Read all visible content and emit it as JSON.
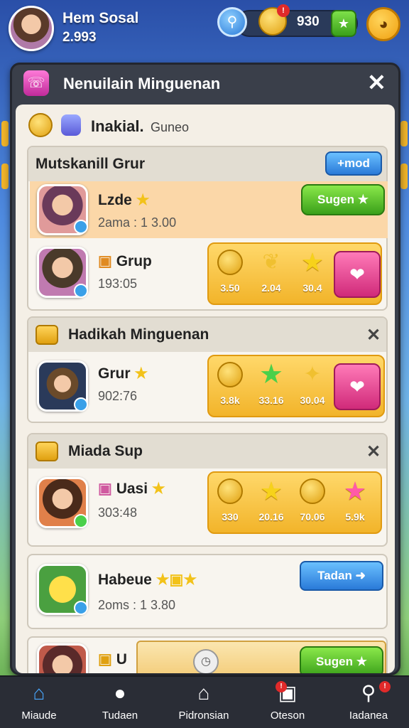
{
  "topbar": {
    "player_name": "Hem Sosal",
    "player_score": "2.993",
    "coin_badge": "!",
    "coin_count": "930"
  },
  "panel": {
    "title": "Nenuilain Minguenan",
    "filter_label": "Inakial.",
    "filter_sub": "Guneo"
  },
  "sections": {
    "group": {
      "title": "Mutskanill Grur",
      "button": "+mod",
      "featured": {
        "name": "Lzde",
        "meta": "2ama : 1 3.00",
        "button": "Sugen"
      },
      "row": {
        "name": "Grup",
        "meta": "193:05",
        "rewards": [
          "3.50",
          "2.04",
          "30.4"
        ]
      }
    },
    "weekly": {
      "title": "Hadikah Minguenan",
      "row": {
        "name": "Grur",
        "meta": "902:76",
        "rewards": [
          "3.8k",
          "33.16",
          "30.04"
        ]
      }
    },
    "miada": {
      "title": "Miada Sup",
      "row": {
        "name": "Uasi",
        "meta": "303:48",
        "rewards": [
          "330",
          "20.16",
          "70.06",
          "5.9k"
        ]
      }
    },
    "mabeue": {
      "name": "Habeue",
      "meta": "2oms : 1 3.80",
      "button": "Tadan"
    },
    "partial": {
      "name": "U",
      "button": "Sugen"
    }
  },
  "nav": [
    {
      "label": "Miaude",
      "icon": "home-icon"
    },
    {
      "label": "Tudaen",
      "icon": "friends-icon"
    },
    {
      "label": "Pidronsian",
      "icon": "shop-icon"
    },
    {
      "label": "Oteson",
      "icon": "gift-icon",
      "badge": "!"
    },
    {
      "label": "Iadanea",
      "icon": "search-icon",
      "badge": "!"
    }
  ],
  "colors": {
    "panel_dark": "#3a3f4a",
    "panel_light": "#f4efe6",
    "green_button": "#3aa01a",
    "blue_button": "#2a7ad8",
    "reward_gold": "#f2b42a",
    "highlight_row": "#fbd7a8"
  }
}
